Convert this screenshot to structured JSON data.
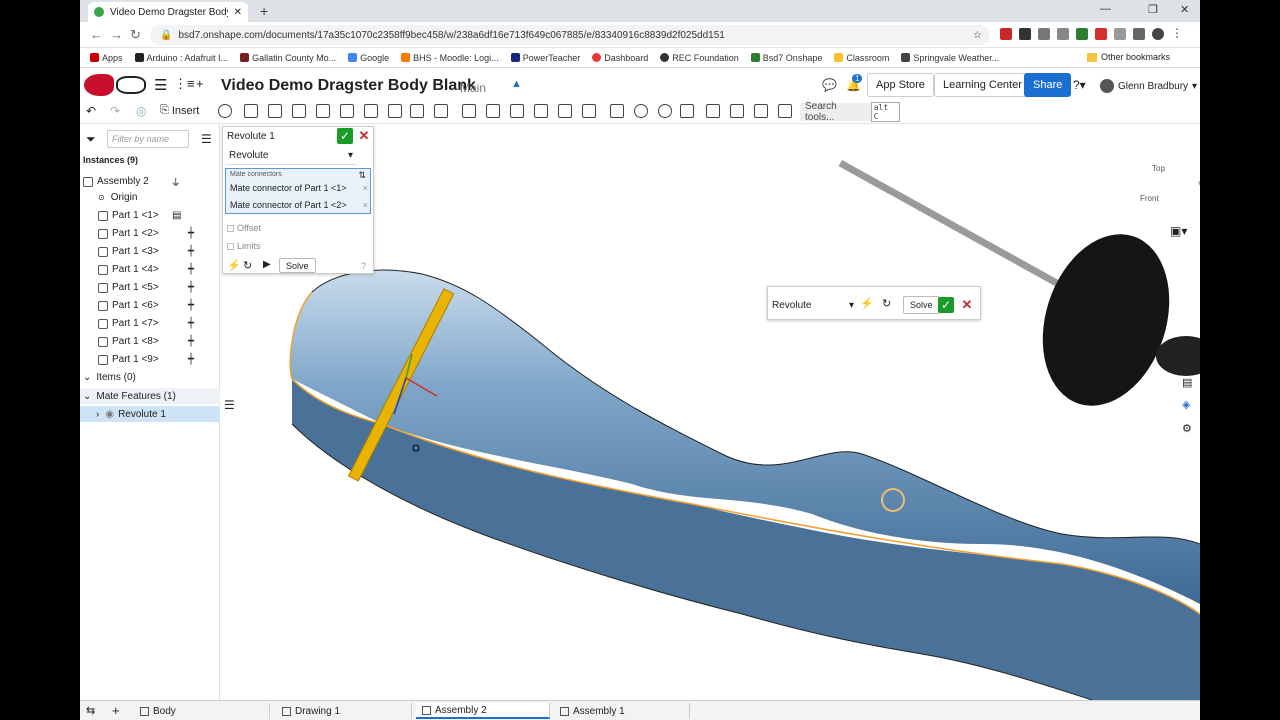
{
  "browser": {
    "tab_title": "Video Demo Dragster Body Blank",
    "new_tab": "+",
    "url": "bsd7.onshape.com/documents/17a35c1070c2358ff9bec458/w/238a6df16e713f649c067885/e/83340916c8839d2f025dd151",
    "bookmarks": [
      "Apps",
      "Arduino : Adafruit I...",
      "Gallatin County Mo...",
      "Google",
      "BHS - Moodle: Logi...",
      "PowerTeacher",
      "Dashboard",
      "REC Foundation",
      "Bsd7 Onshape",
      "Classroom",
      "Springvale Weather..."
    ],
    "other_bookmarks": "Other bookmarks"
  },
  "header": {
    "doc_title": "Video Demo Dragster Body Blank",
    "branch": "Main",
    "app_store": "App Store",
    "learning_center": "Learning Center",
    "share": "Share",
    "user": "Glenn Bradbury",
    "notif_count": "1"
  },
  "toolbar": {
    "insert": "Insert",
    "search_tools": "Search tools...",
    "shortcut": "alt C"
  },
  "tree": {
    "filter_placeholder": "Filter by name",
    "instances": "Instances (9)",
    "assembly": "Assembly 2",
    "origin": "Origin",
    "parts": [
      "Part 1 <1>",
      "Part 1 <2>",
      "Part 1 <3>",
      "Part 1 <4>",
      "Part 1 <5>",
      "Part 1 <6>",
      "Part 1 <7>",
      "Part 1 <8>",
      "Part 1 <9>"
    ],
    "items": "Items (0)",
    "mate_features": "Mate Features (1)",
    "revolute": "Revolute 1"
  },
  "dialog": {
    "title": "Revolute 1",
    "type": "Revolute",
    "mc_label": "Mate connectors",
    "mc1": "Mate connector of Part 1 <1>",
    "mc2": "Mate connector of Part 1 <2>",
    "offset": "Offset",
    "limits": "Limits",
    "solve": "Solve"
  },
  "floating": {
    "type": "Revolute",
    "solve": "Solve"
  },
  "viewcube": {
    "top": "Top",
    "front": "Front"
  },
  "bottom_tabs": [
    "Body",
    "Drawing 1",
    "Assembly 2",
    "Assembly 1"
  ],
  "colors": {
    "share": "#1a6fd1",
    "ok": "#1b9b28",
    "body": "#5f8fb8",
    "highlight": "#f0a030"
  }
}
